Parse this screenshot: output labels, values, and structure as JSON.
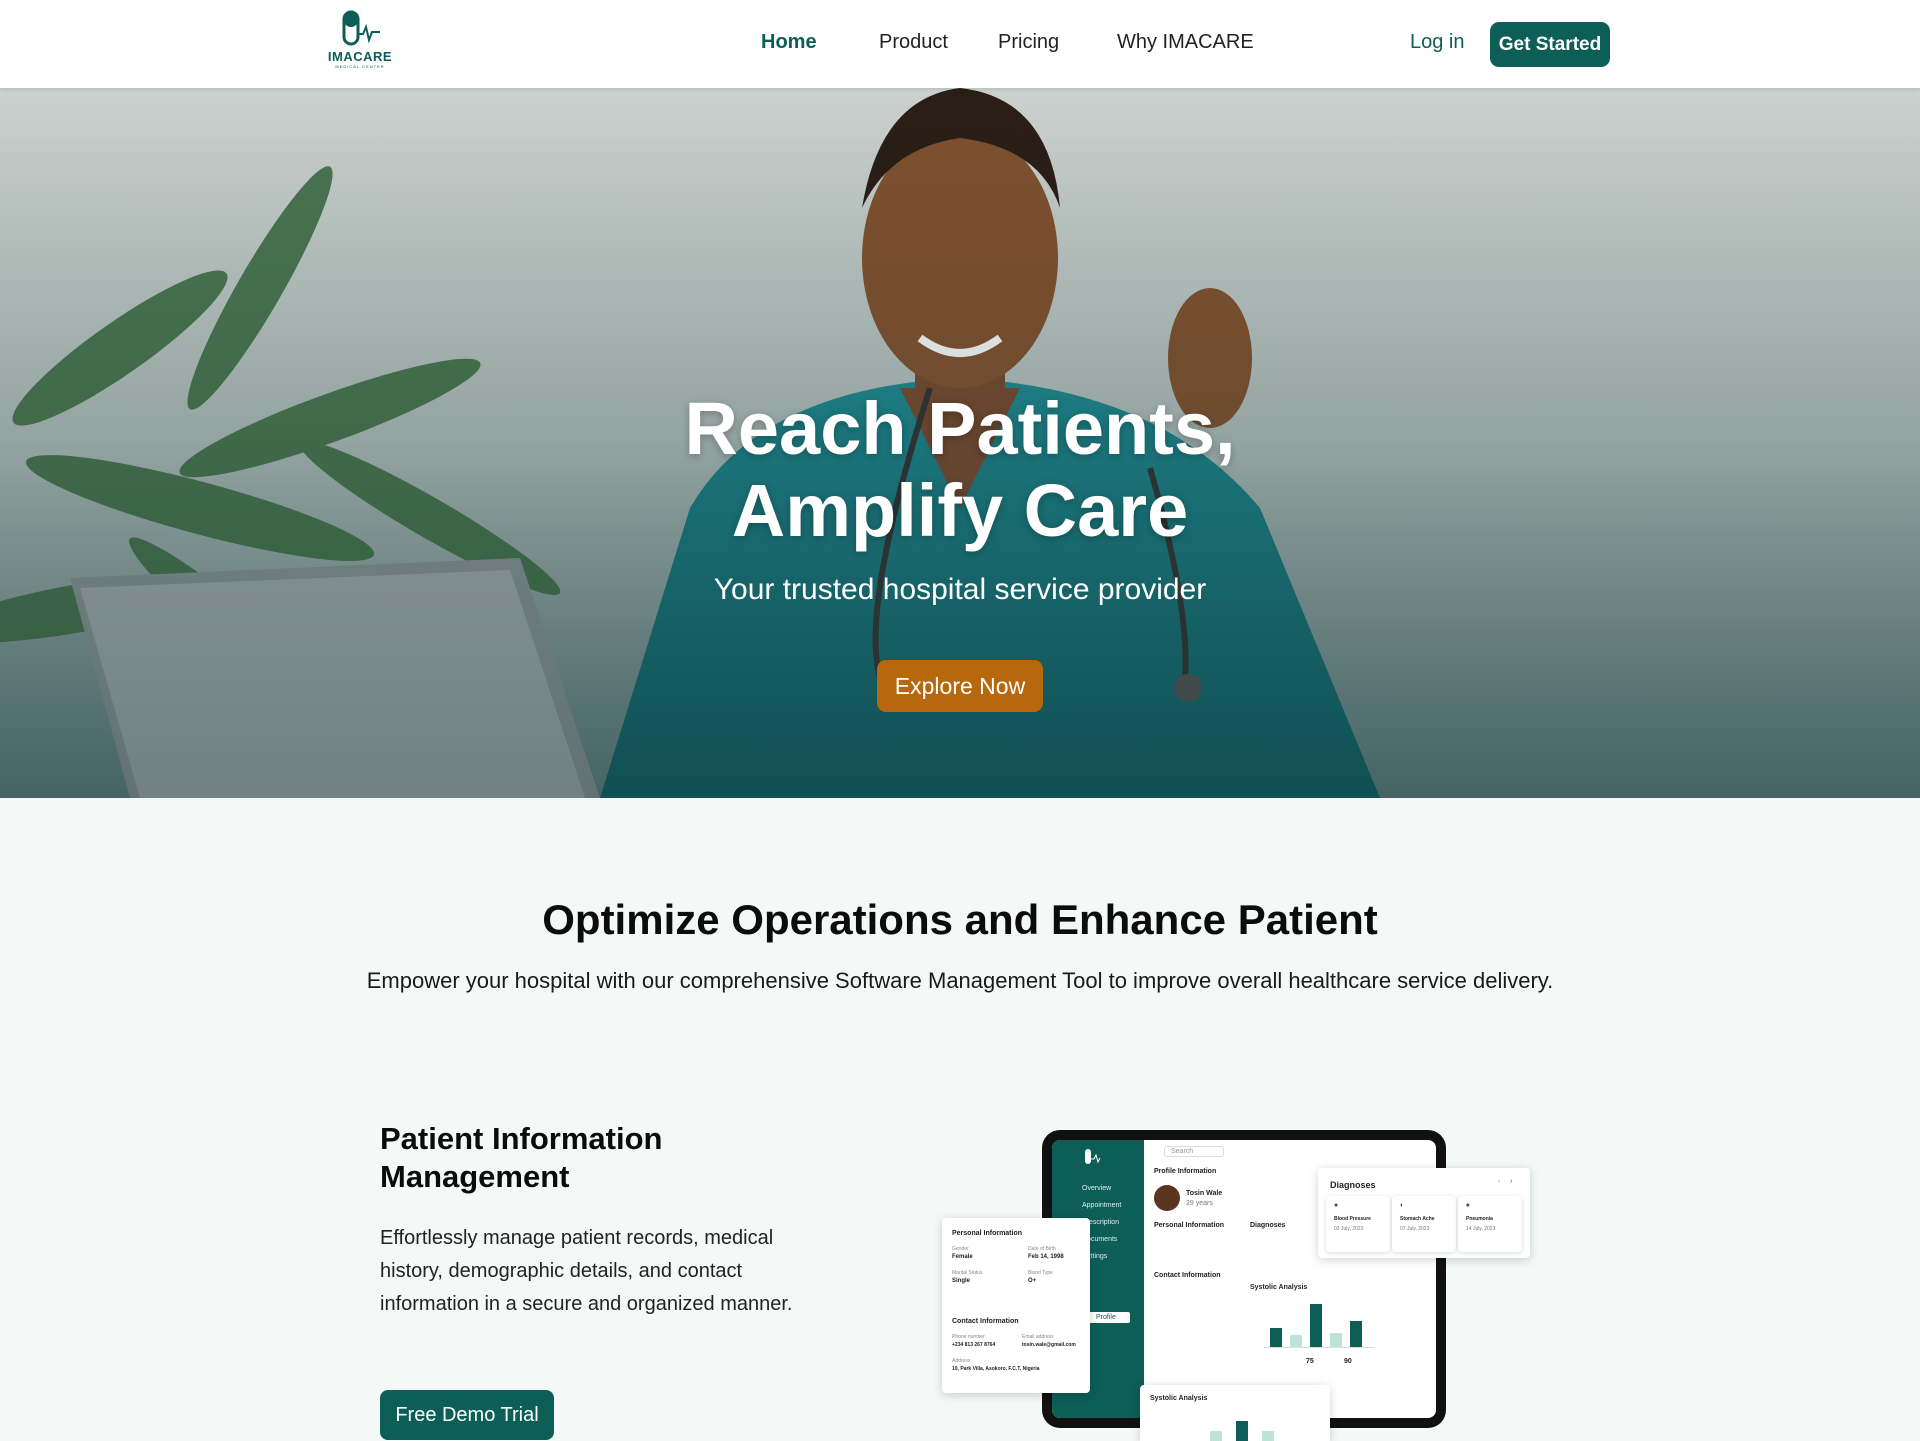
{
  "brand": {
    "name": "IMACARE",
    "tagline": "MEDICAL CENTER"
  },
  "nav": {
    "links": [
      {
        "label": "Home",
        "active": true
      },
      {
        "label": "Product",
        "active": false
      },
      {
        "label": "Pricing",
        "active": false
      },
      {
        "label": "Why IMACARE",
        "active": false
      }
    ],
    "login": "Log in",
    "get_started": "Get Started"
  },
  "hero": {
    "title_line1": "Reach Patients,",
    "title_line2": "Amplify Care",
    "subtitle": "Your trusted hospital service provider",
    "cta": "Explore Now"
  },
  "section": {
    "title": "Optimize Operations and Enhance Patient",
    "subtitle": "Empower your hospital with our comprehensive Software Management Tool to improve overall healthcare service delivery."
  },
  "feature": {
    "title": "Patient Information Management",
    "text": "Effortlessly manage patient records, medical history, demographic details, and contact information in a secure and organized manner.",
    "cta": "Free Demo Trial"
  },
  "mockup": {
    "sidebar": [
      "Overview",
      "Appointment",
      "Prescription",
      "Documents",
      "Settings",
      "Profile"
    ],
    "profile_heading": "Profile Information",
    "patient_name": "Tosin Wale",
    "patient_age": "29 years",
    "personal_heading": "Personal Information",
    "contact_heading": "Contact Information",
    "gender_label": "Gender",
    "gender": "Female",
    "dob_label": "Date of Birth",
    "dob": "Feb 14, 1998",
    "marital_label": "Marital Status",
    "marital": "Single",
    "blood_label": "Blood Type",
    "blood": "O+",
    "phone_label": "Phone number",
    "phone": "+234 813 267 8764",
    "email_label": "Email address",
    "email": "tosin.wale@gmail.com",
    "address_label": "Address",
    "address": "10, Park Villa, Asokoro, F.C.T, Nigeria",
    "diagnoses_heading": "Diagnoses",
    "diagnoses": [
      {
        "name": "Blood Pressure",
        "date": "03 July, 2023"
      },
      {
        "name": "Stomach Ache",
        "date": "07 July, 2023"
      },
      {
        "name": "Pneumonia",
        "date": "14 July, 2023"
      }
    ],
    "systolic_heading": "Systolic Analysis",
    "search_placeholder": "Search",
    "stat1": "75",
    "stat2": "90",
    "bars": [
      0.4,
      0.25,
      0.9,
      0.3,
      0.55
    ]
  }
}
